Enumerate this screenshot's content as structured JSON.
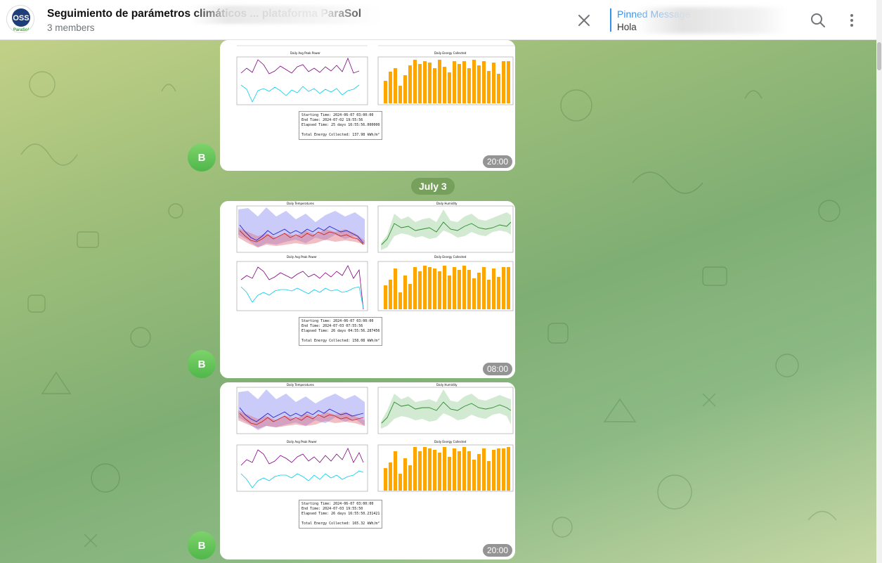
{
  "header": {
    "title": "Seguimiento de parámetros climáticos ... plataforma ParaSol",
    "members": "3 members",
    "pinned_label": "Pinned Message",
    "pinned_text": "Hola"
  },
  "logo": {
    "line1": "OSS",
    "line2": "ParaSol"
  },
  "date_separator": "July 3",
  "messages": [
    {
      "sender_initial": "B",
      "time": "20:00",
      "stats": [
        "Starting Time: 2024-06-07 03:00:00",
        "End Time: 2024-07-02 19:55:56",
        "Elapsed Time: 25 days 16:55:56.000000",
        "",
        "Total Energy Collected: 137.98 kWh/m²"
      ]
    },
    {
      "sender_initial": "B",
      "time": "08:00",
      "stats": [
        "Starting Time: 2024-06-07 03:00:00",
        "End Time: 2024-07-03 07:55:56",
        "Elapsed Time: 26 days 04:55:56.287456",
        "",
        "Total Energy Collected: 158.08 kWh/m²"
      ]
    },
    {
      "sender_initial": "B",
      "time": "20:00",
      "stats": [
        "Starting Time: 2024-06-07 03:00:00",
        "End Time: 2024-07-03 19:55:50",
        "Elapsed Time: 26 days 16:55:50.231421",
        "",
        "Total Energy Collected: 165.32 kWh/m²"
      ]
    }
  ],
  "panels": {
    "temps": "Daily Temperatures",
    "humidity": "Daily Humidity",
    "power": "Daily Avg Peak Power",
    "energy": "Daily Energy Collected"
  },
  "colors": {
    "accent": "#3390ec",
    "energy_bar": "#ffa500",
    "humidity": "#2e8b2e",
    "peak_power": "#800080",
    "avg_power": "#00cfe8"
  }
}
